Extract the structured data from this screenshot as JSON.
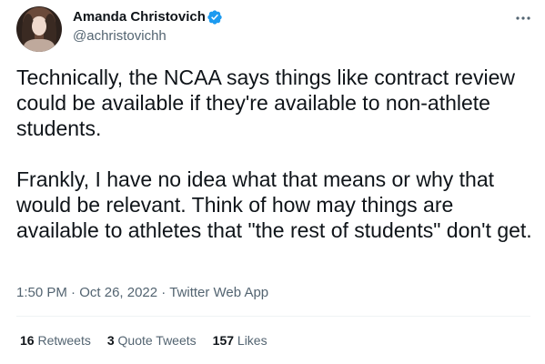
{
  "author": {
    "display_name": "Amanda Christovich",
    "handle": "@achristovichh",
    "verified": true
  },
  "tweet": {
    "paragraphs": [
      "Technically, the NCAA says things like contract review could be available if they're available to non-athlete students.",
      "Frankly, I have no idea what that means or why that would be relevant. Think of how may things are available to athletes that \"the rest of students\" don't get."
    ],
    "time": "1:50 PM",
    "date": "Oct 26, 2022",
    "separator": "·",
    "source": "Twitter Web App"
  },
  "stats": {
    "retweets": {
      "count": "16",
      "label": "Retweets"
    },
    "quote_tweets": {
      "count": "3",
      "label": "Quote Tweets"
    },
    "likes": {
      "count": "157",
      "label": "Likes"
    }
  },
  "icons": {
    "more": "more-options-icon",
    "verified": "verified-badge-icon"
  },
  "colors": {
    "verified_blue": "#1d9bf0",
    "text_primary": "#0f1419",
    "text_secondary": "#536471",
    "divider": "#eff3f4"
  }
}
